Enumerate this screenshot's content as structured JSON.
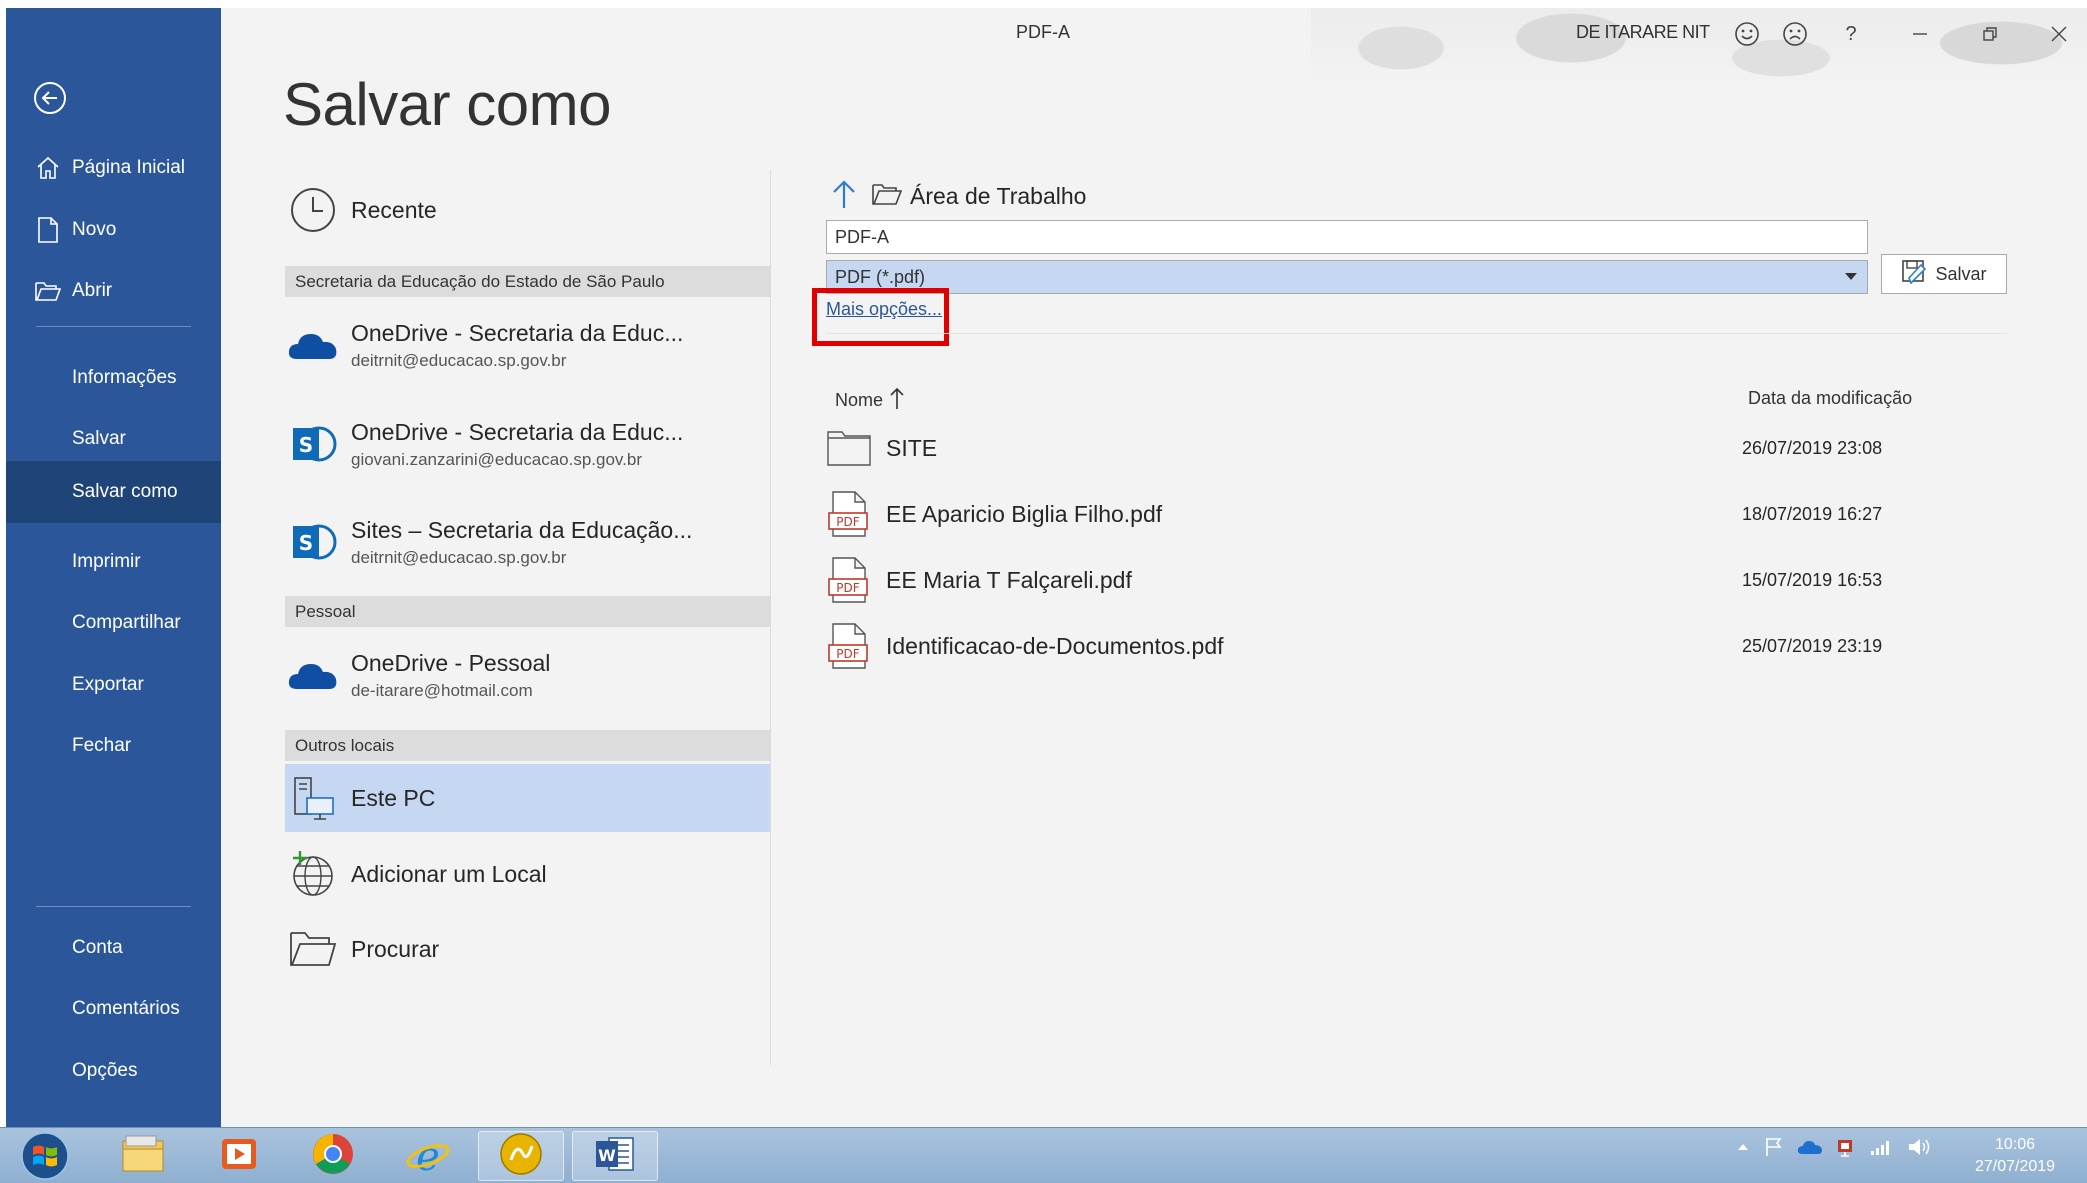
{
  "window": {
    "doc_title": "PDF-A",
    "user_name": "DE ITARARE NIT",
    "help_label": "?"
  },
  "nav": {
    "items_top": [
      {
        "label": "Página Inicial",
        "icon": "home-icon"
      },
      {
        "label": "Novo",
        "icon": "new-document-icon"
      },
      {
        "label": "Abrir",
        "icon": "open-folder-icon"
      }
    ],
    "items_mid": [
      {
        "label": "Informações"
      },
      {
        "label": "Salvar"
      },
      {
        "label": "Salvar como",
        "active": true
      },
      {
        "label": "Imprimir"
      },
      {
        "label": "Compartilhar"
      },
      {
        "label": "Exportar"
      },
      {
        "label": "Fechar"
      }
    ],
    "items_bottom": [
      {
        "label": "Conta"
      },
      {
        "label": "Comentários"
      },
      {
        "label": "Opções"
      }
    ]
  },
  "page_title": "Salvar como",
  "places": {
    "recent": "Recente",
    "section_edu": "Secretaria da Educação do Estado de São Paulo",
    "onedrive_edu_1": {
      "title": "OneDrive - Secretaria da Educ...",
      "sub": "deitrnit@educacao.sp.gov.br"
    },
    "onedrive_edu_2": {
      "title": "OneDrive - Secretaria da Educ...",
      "sub": "giovani.zanzarini@educacao.sp.gov.br"
    },
    "sites_edu": {
      "title": "Sites – Secretaria da Educação...",
      "sub": "deitrnit@educacao.sp.gov.br"
    },
    "section_personal": "Pessoal",
    "onedrive_personal": {
      "title": "OneDrive - Pessoal",
      "sub": "de-itarare@hotmail.com"
    },
    "section_other": "Outros locais",
    "this_pc": "Este PC",
    "add_place": "Adicionar um Local",
    "browse": "Procurar"
  },
  "pane": {
    "location": "Área de Trabalho",
    "filename": "PDF-A",
    "filetype": "PDF (*.pdf)",
    "save_label": "Salvar",
    "more_options": "Mais opções...",
    "col_name": "Nome",
    "col_date": "Data da modificação",
    "files": [
      {
        "name": "SITE",
        "date": "26/07/2019 23:08",
        "type": "folder"
      },
      {
        "name": "EE Aparicio Biglia Filho.pdf",
        "date": "18/07/2019 16:27",
        "type": "pdf"
      },
      {
        "name": "EE Maria T Falçareli.pdf",
        "date": "15/07/2019 16:53",
        "type": "pdf"
      },
      {
        "name": "Identificacao-de-Documentos.pdf",
        "date": "25/07/2019 23:19",
        "type": "pdf"
      }
    ],
    "pdf_badge": "PDF"
  },
  "taskbar": {
    "time": "10:06",
    "date": "27/07/2019"
  },
  "colors": {
    "nav_bg": "#2b579a",
    "nav_active": "#1f4477",
    "selected_place": "#c5d7f1",
    "highlight": "#e00000"
  }
}
